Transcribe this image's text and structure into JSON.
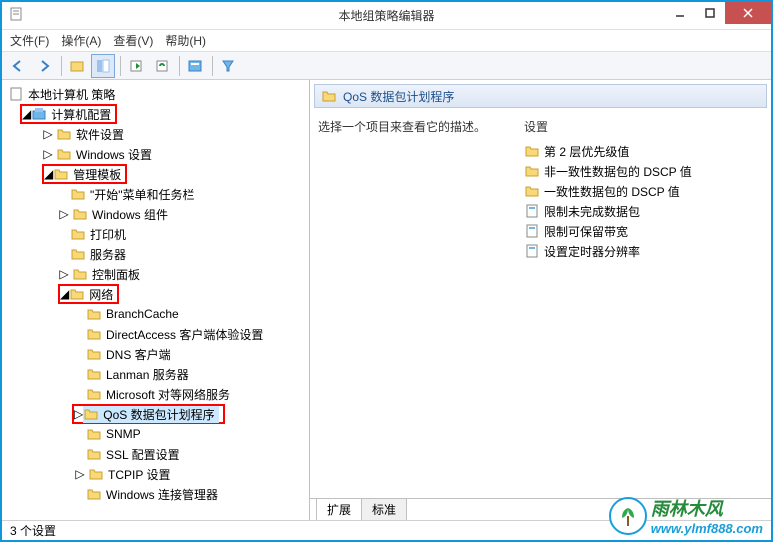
{
  "title": "本地组策略编辑器",
  "menu": {
    "file": "文件(F)",
    "action": "操作(A)",
    "view": "查看(V)",
    "help": "帮助(H)"
  },
  "tree": {
    "root": "本地计算机 策略",
    "computer_config": "计算机配置",
    "software_settings": "软件设置",
    "windows_settings": "Windows 设置",
    "admin_templates": "管理模板",
    "start_taskbar": "\"开始\"菜单和任务栏",
    "windows_components": "Windows 组件",
    "printers": "打印机",
    "servers": "服务器",
    "control_panel": "控制面板",
    "network": "网络",
    "branchcache": "BranchCache",
    "directaccess": "DirectAccess 客户端体验设置",
    "dns_client": "DNS 客户端",
    "lanman_server": "Lanman 服务器",
    "ms_p2p": "Microsoft 对等网络服务",
    "qos": "QoS 数据包计划程序",
    "snmp": "SNMP",
    "ssl_config": "SSL 配置设置",
    "tcpip": "TCPIP 设置",
    "windows_conn_mgr": "Windows 连接管理器"
  },
  "detail": {
    "header": "QoS 数据包计划程序",
    "prompt": "选择一个项目来查看它的描述。",
    "section": "设置",
    "items": {
      "i0": "第 2 层优先级值",
      "i1": "非一致性数据包的 DSCP 值",
      "i2": "一致性数据包的 DSCP 值",
      "i3": "限制未完成数据包",
      "i4": "限制可保留带宽",
      "i5": "设置定时器分辨率"
    }
  },
  "tabs": {
    "ext": "扩展",
    "std": "标准"
  },
  "status": "3 个设置",
  "watermark": {
    "cn": "雨林木风",
    "url": "www.ylmf888.com"
  }
}
